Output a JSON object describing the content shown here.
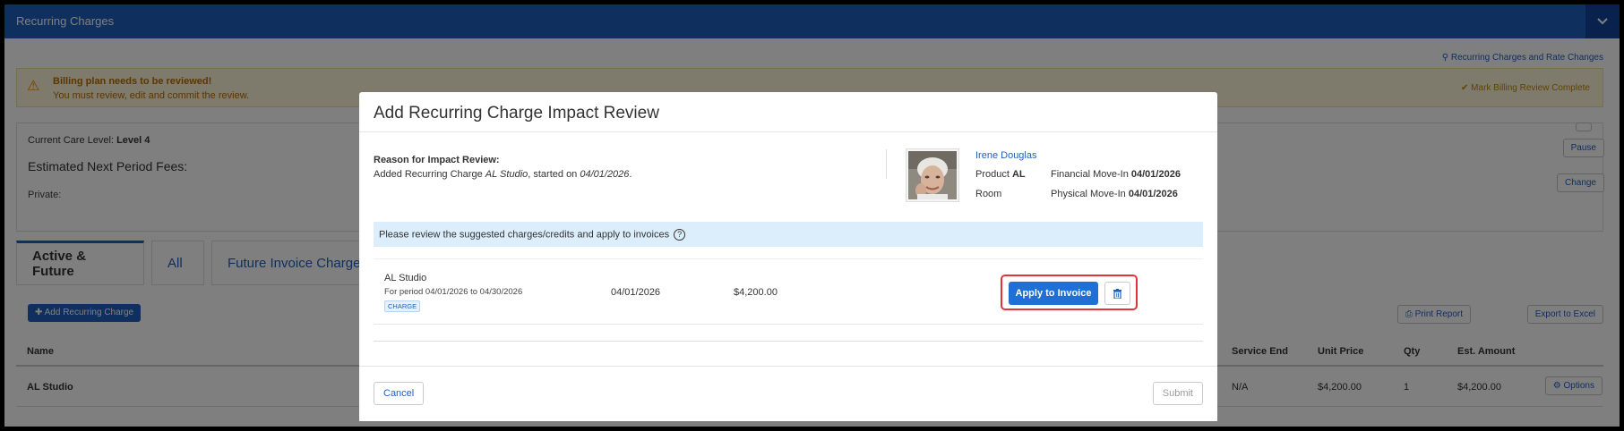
{
  "panel": {
    "title": "Recurring Charges",
    "collapse_icon": "chevron-down-icon",
    "rate_changes_link": "Recurring Charges and Rate Changes"
  },
  "alert": {
    "title": "Billing plan needs to be reviewed!",
    "message": "You must review, edit and commit the review.",
    "action": "Mark Billing Review Complete",
    "accent": "#b66d00"
  },
  "care": {
    "care_level_label": "Current Care Level:",
    "care_level_value": "Level 4",
    "fees_label": "Estimated Next Period Fees:",
    "private_label": "Private:",
    "pause_label": "Pause",
    "change_label": "Change"
  },
  "tabs": [
    "Active & Future",
    "All",
    "Future Invoice Charges"
  ],
  "toolbar": {
    "add_label": "Add Recurring Charge",
    "print_label": "Print Report",
    "excel_label": "Export to Excel"
  },
  "table": {
    "columns": [
      "Name",
      "Service End",
      "Unit Price",
      "Qty",
      "Est. Amount"
    ],
    "rows": [
      {
        "name": "AL Studio",
        "service_end": "N/A",
        "unit_price": "$4,200.00",
        "qty": "1",
        "est_amount": "$4,200.00",
        "options": "Options"
      }
    ]
  },
  "modal": {
    "title": "Add Recurring Charge Impact Review",
    "reason_heading": "Reason for Impact Review:",
    "reason_prefix": "Added Recurring Charge ",
    "reason_charge": "AL Studio",
    "reason_mid": ", started on ",
    "reason_date": "04/01/2026",
    "reason_end": ".",
    "resident": {
      "name": "Irene Douglas",
      "product_label": "Product",
      "product_value": "AL",
      "room_label": "Room",
      "financial_label": "Financial Move-In",
      "financial_value": "04/01/2026",
      "physical_label": "Physical Move-In",
      "physical_value": "04/01/2026"
    },
    "info_text": "Please review the suggested charges/credits and apply to invoices",
    "charge": {
      "name": "AL Studio",
      "period": "For period 04/01/2026 to 04/30/2026",
      "badge": "CHARGE",
      "date": "04/01/2026",
      "amount": "$4,200.00",
      "apply_label": "Apply to Invoice"
    },
    "cancel_label": "Cancel",
    "submit_label": "Submit"
  },
  "colors": {
    "brand": "#1f5fbf",
    "highlight": "#e0343a"
  }
}
